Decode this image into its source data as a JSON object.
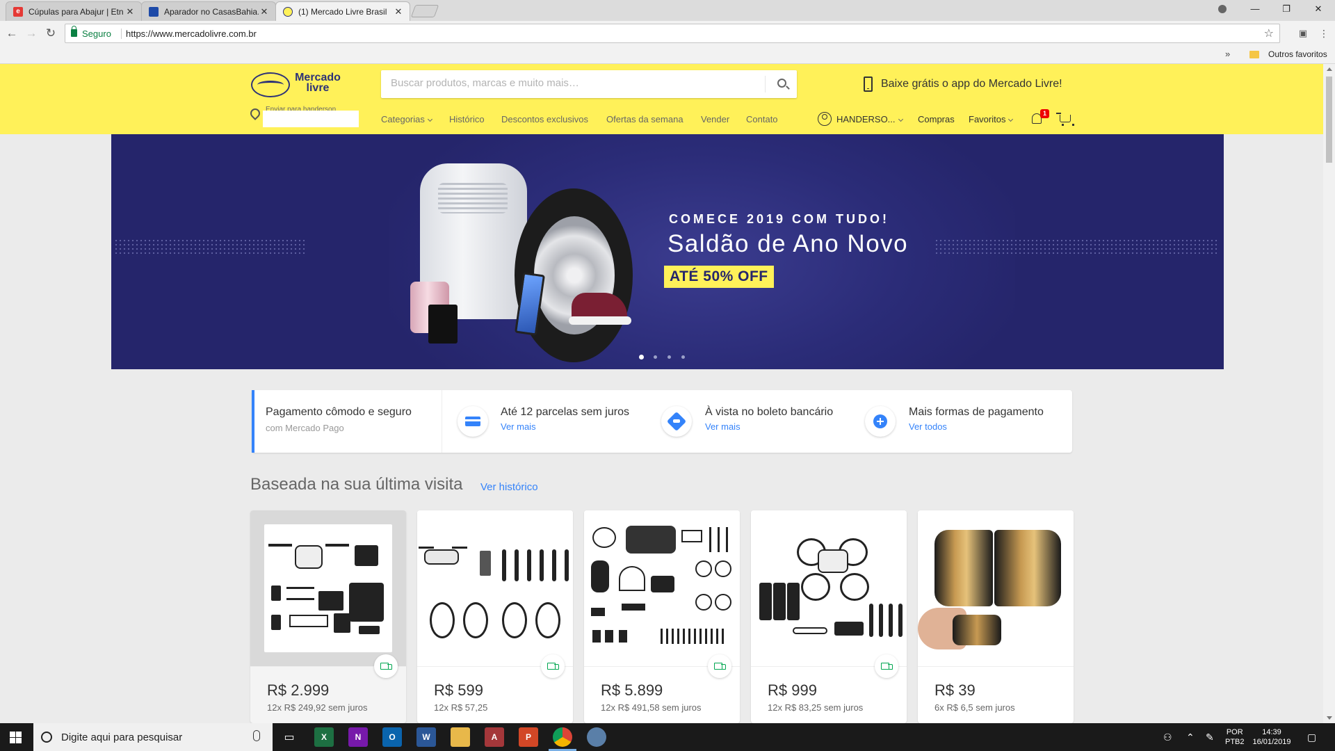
{
  "browser": {
    "tabs": [
      {
        "label": "Cúpulas para Abajur | Etn",
        "favicon_color": "#e53935",
        "favicon_letter": "e",
        "active": false
      },
      {
        "label": "Aparador no CasasBahia.c",
        "favicon_color": "#1e4aa8",
        "favicon_letter": "",
        "active": false
      },
      {
        "label": "(1) Mercado Livre Brasil",
        "favicon_color": "#fff159",
        "favicon_letter": "",
        "active": true
      }
    ],
    "close_glyph": "✕",
    "secure_label": "Seguro",
    "url": "https://www.mercadolivre.com.br",
    "bookmarks_overflow": "»",
    "bookmarks_folder": "Outros favoritos",
    "window_controls": [
      "—",
      "❐",
      "✕"
    ]
  },
  "header": {
    "logo_line1": "Mercado",
    "logo_line2": "livre",
    "search_placeholder": "Buscar produtos, marcas e muito mais…",
    "app_promo": "Baixe grátis o app do Mercado Livre!",
    "location_label": "Enviar para handerson",
    "nav": [
      "Categorias",
      "Histórico",
      "Descontos exclusivos",
      "Ofertas da semana",
      "Vender",
      "Contato"
    ],
    "user_name": "HANDERSO...",
    "purchases": "Compras",
    "favorites": "Favoritos",
    "notification_count": "1",
    "brand_color": "#fff159"
  },
  "banner": {
    "subtitle": "COMECE 2019 COM TUDO!",
    "title": "Saldão de Ano Novo",
    "badge": "ATÉ 50% OFF",
    "slide_count": 4,
    "active_slide": 1,
    "background": "#25256b"
  },
  "payment": {
    "main_title": "Pagamento cômodo e seguro",
    "main_sub": "com Mercado Pago",
    "items": [
      {
        "title": "Até 12 parcelas sem juros",
        "link": "Ver mais",
        "icon": "credit-card-icon"
      },
      {
        "title": "À vista no boleto bancário",
        "link": "Ver mais",
        "icon": "handshake-icon"
      },
      {
        "title": "Mais formas de pagamento",
        "link": "Ver todos",
        "icon": "plus-circle-icon"
      }
    ],
    "accent_color": "#3483fa"
  },
  "recommendations": {
    "title": "Baseada na sua última visita",
    "link": "Ver histórico",
    "products": [
      {
        "price": "R$ 2.999",
        "installments": "12x R$ 249,92 sem juros",
        "image": "drone-kit-image"
      },
      {
        "price": "R$ 599",
        "installments": "12x R$ 57,25",
        "image": "drone-propellers-image"
      },
      {
        "price": "R$ 5.899",
        "installments": "12x R$ 491,58 sem juros",
        "image": "drone-accessories-image"
      },
      {
        "price": "R$ 999",
        "installments": "12x R$ 83,25 sem juros",
        "image": "drone-batteries-image"
      },
      {
        "price": "R$ 39",
        "installments": "6x R$ 6,5 sem juros",
        "image": "sun-hood-image"
      }
    ]
  },
  "taskbar": {
    "search_placeholder": "Digite aqui para pesquisar",
    "apps": [
      {
        "letter": "X",
        "color": "#1d6f42",
        "name": "excel"
      },
      {
        "letter": "N",
        "color": "#7719aa",
        "name": "onenote"
      },
      {
        "letter": "O",
        "color": "#0a64ad",
        "name": "outlook"
      },
      {
        "letter": "W",
        "color": "#2b5797",
        "name": "word"
      },
      {
        "letter": "",
        "color": "#e8b84a",
        "name": "explorer"
      },
      {
        "letter": "A",
        "color": "#a4373a",
        "name": "access"
      },
      {
        "letter": "P",
        "color": "#d24726",
        "name": "powerpoint"
      },
      {
        "letter": "",
        "color": "#db4437",
        "name": "chrome"
      },
      {
        "letter": "",
        "color": "#5a7fa8",
        "name": "paint"
      }
    ],
    "lang_line1": "POR",
    "lang_line2": "PTB2",
    "time": "14:39",
    "date": "16/01/2019"
  }
}
